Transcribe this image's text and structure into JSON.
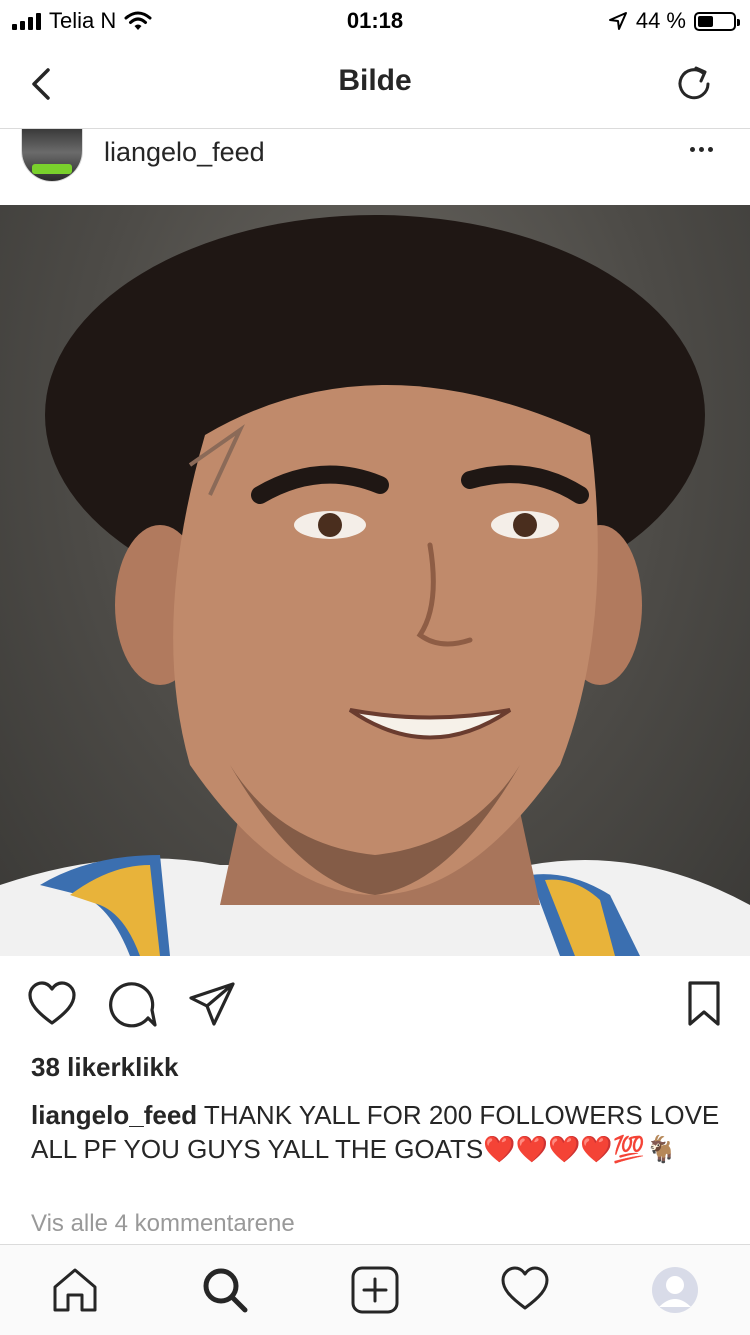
{
  "status_bar": {
    "carrier": "Telia N",
    "time": "01:18",
    "battery_percent": "44 %",
    "battery_level": 0.44
  },
  "nav": {
    "title": "Bilde",
    "back_icon": "chevron-left-icon",
    "refresh_icon": "refresh-icon"
  },
  "post": {
    "username": "liangelo_feed",
    "more_icon": "more-horizontal-icon",
    "photo_alt": "portrait-photo",
    "likes": "38 likerklikk",
    "caption_user": "liangelo_feed",
    "caption_text": "THANK YALL FOR 200 FOLLOWERS LOVE ALL PF YOU GUYS YALL THE GOATS",
    "caption_emojis": "❤️❤️❤️❤️💯🐐",
    "view_comments": "Vis alle 4 kommentarene"
  },
  "actions": [
    "heart-icon",
    "comment-icon",
    "share-icon",
    "bookmark-icon"
  ],
  "tabs": [
    "home-icon",
    "search-icon",
    "add-icon",
    "activity-heart-icon",
    "profile-icon"
  ],
  "colors": {
    "text": "#262626",
    "muted": "#999999",
    "divider": "#dbdbdb",
    "heart_emoji": "#e02020",
    "tabbar_bg": "#fafafa"
  }
}
